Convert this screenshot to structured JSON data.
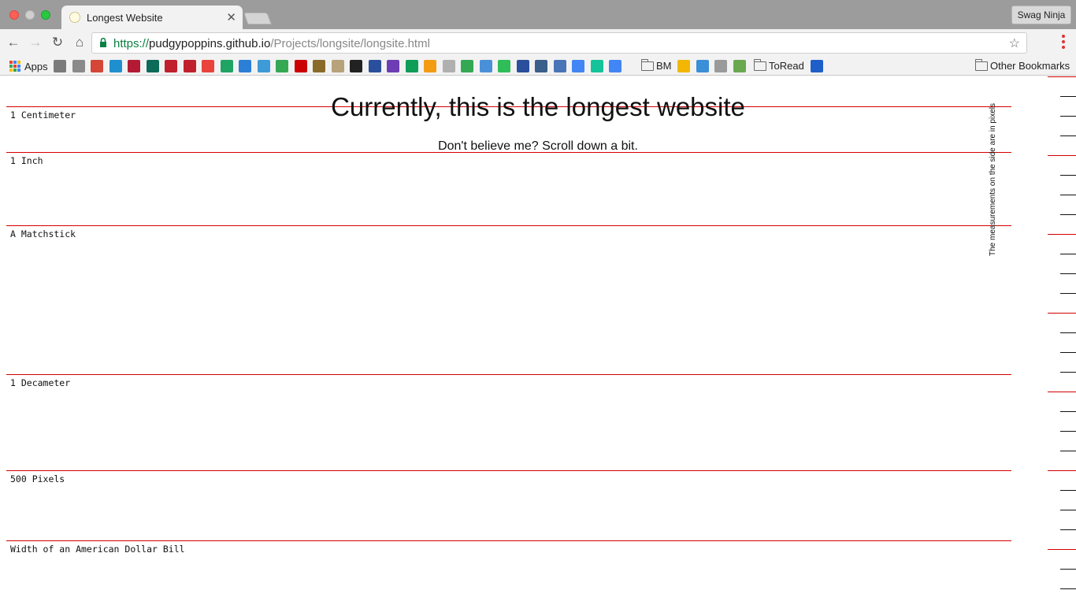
{
  "browser": {
    "tab_title": "Longest Website",
    "tab_close": "✕",
    "profile_name": "Swag Ninja",
    "url_scheme": "https://",
    "url_host": "pudgypoppins.github.io",
    "url_path": "/Projects/longsite/longsite.html"
  },
  "bookmarks": {
    "apps_label": "Apps",
    "bm_folder_label": "BM",
    "toread_folder_label": "ToRead",
    "other_label": "Other Bookmarks",
    "icons": [
      {
        "name": "folder-icon",
        "color": "#7a7a7a"
      },
      {
        "name": "target-icon",
        "color": "#8a8a8a"
      },
      {
        "name": "gmail-icon",
        "color": "#d44638"
      },
      {
        "name": "diamond-icon",
        "color": "#1f8fd0"
      },
      {
        "name": "pocket-icon",
        "color": "#b31b34"
      },
      {
        "name": "p-app-icon",
        "color": "#0d6b5a"
      },
      {
        "name": "infinity-icon",
        "color": "#c0202d"
      },
      {
        "name": "arrow-icon",
        "color": "#c0202d"
      },
      {
        "name": "circle-icon",
        "color": "#e8433c"
      },
      {
        "name": "drive-icon",
        "color": "#1fa463"
      },
      {
        "name": "n-app-icon",
        "color": "#2b7fd6"
      },
      {
        "name": "puzzle-icon",
        "color": "#3f9ad8"
      },
      {
        "name": "maps-icon",
        "color": "#34a853"
      },
      {
        "name": "cnn-icon",
        "color": "#cc0000"
      },
      {
        "name": "k-app-icon",
        "color": "#8a6a2b"
      },
      {
        "name": "figure-icon",
        "color": "#b8a27a"
      },
      {
        "name": "house-icon",
        "color": "#222222"
      },
      {
        "name": "r-circle-icon",
        "color": "#2a4f9c"
      },
      {
        "name": "list-icon",
        "color": "#6c3db5"
      },
      {
        "name": "sheets-icon",
        "color": "#0f9d58"
      },
      {
        "name": "asterisk-icon",
        "color": "#f39c12"
      },
      {
        "name": "seal-icon",
        "color": "#b0b0b0"
      },
      {
        "name": "maps2-icon",
        "color": "#34a853"
      },
      {
        "name": "cloud-icon",
        "color": "#4a90d9"
      },
      {
        "name": "spotify-icon",
        "color": "#2ebd59"
      },
      {
        "name": "r-circle2-icon",
        "color": "#2a4f9c"
      },
      {
        "name": "building-icon",
        "color": "#3b5f8a"
      },
      {
        "name": "code-icon",
        "color": "#4a74b8"
      },
      {
        "name": "google-icon",
        "color": "#4285f4"
      },
      {
        "name": "grammarly-icon",
        "color": "#15c39a"
      },
      {
        "name": "docs-icon",
        "color": "#4285f4"
      }
    ],
    "icons_after_bm": [
      {
        "name": "bees-icon",
        "color": "#f2b705"
      },
      {
        "name": "swirl-icon",
        "color": "#3a8fd6"
      },
      {
        "name": "page-icon",
        "color": "#9a9a9a"
      },
      {
        "name": "q-app-icon",
        "color": "#6aa84f"
      }
    ],
    "icons_after_toread": [
      {
        "name": "stripe-icon",
        "color": "#1f5fc8"
      }
    ]
  },
  "page": {
    "headline": "Currently, this is the longest website",
    "subheadline": "Don't believe me? Scroll down a bit.",
    "side_note": "The measurements on the side are in pixels",
    "measurements": [
      "1 Centimeter",
      "1 Inch",
      "A Matchstick",
      "1 Decameter",
      "500 Pixels",
      "Width of an American Dollar Bill"
    ]
  }
}
